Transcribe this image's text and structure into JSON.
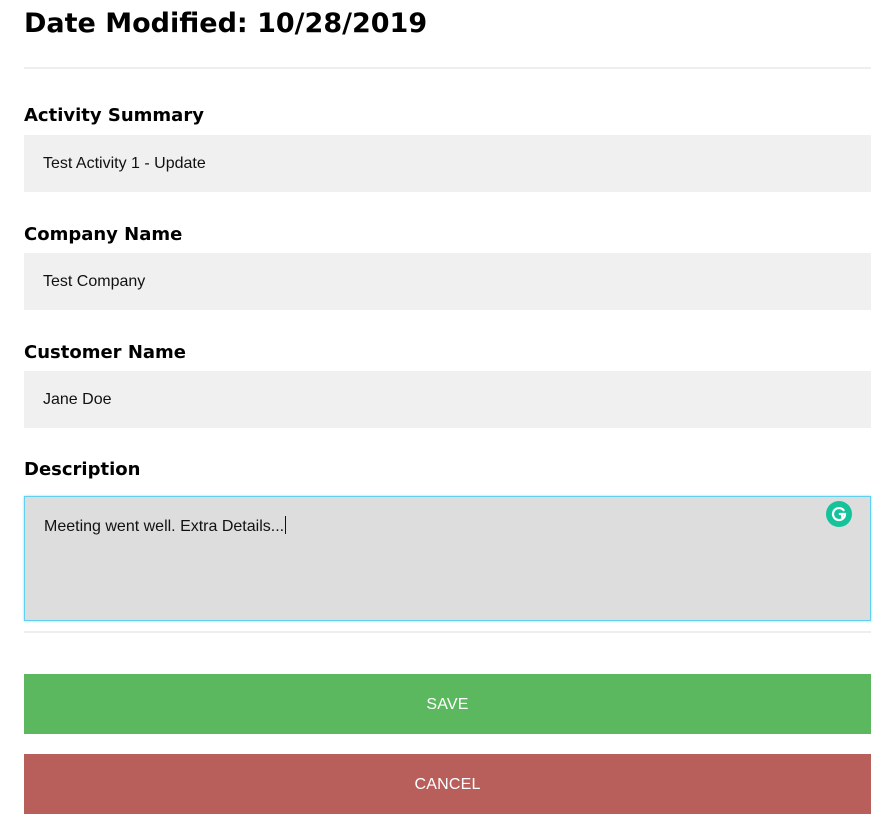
{
  "header": {
    "title": "Date Modified: 10/28/2019"
  },
  "form": {
    "activity_summary": {
      "label": "Activity Summary",
      "value": "Test Activity 1 - Update"
    },
    "company_name": {
      "label": "Company Name",
      "value": "Test Company"
    },
    "customer_name": {
      "label": "Customer Name",
      "value": "Jane Doe"
    },
    "description": {
      "label": "Description",
      "value": "Meeting went well. Extra Details...",
      "extension_icon": "grammarly-icon"
    }
  },
  "actions": {
    "save_label": "SAVE",
    "cancel_label": "CANCEL"
  },
  "colors": {
    "save": "#5cb85f",
    "cancel": "#b85f5c",
    "input_bg": "#f0f0f0",
    "textarea_bg": "#dddddd",
    "focus_border": "#5fd0f0",
    "grammarly": "#15c39a"
  }
}
